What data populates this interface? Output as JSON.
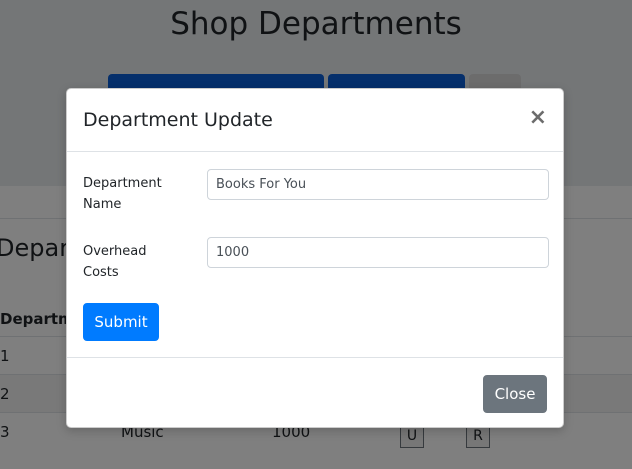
{
  "background": {
    "page_title": "Shop Departments",
    "card_title": "Depart",
    "table_header_first": "Departm",
    "rows": [
      {
        "id": "1",
        "name": "",
        "cost": ""
      },
      {
        "id": "2",
        "name": "",
        "cost": ""
      },
      {
        "id": "3",
        "name": "Music",
        "cost": "1000"
      }
    ],
    "update_label": "U",
    "remove_label": "R"
  },
  "modal": {
    "title": "Department Update",
    "close_glyph": "×",
    "fields": [
      {
        "label": "Department Name",
        "value": "Books For You"
      },
      {
        "label": "Overhead Costs",
        "value": "1000"
      }
    ],
    "submit_label": "Submit",
    "close_label": "Close"
  }
}
